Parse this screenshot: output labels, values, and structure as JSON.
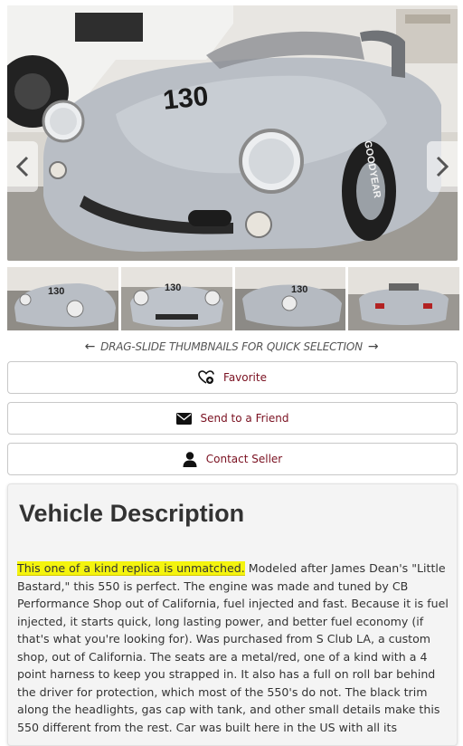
{
  "gallery": {
    "prev_icon": "chevron-left-icon",
    "next_icon": "chevron-right-icon",
    "car_number": "130",
    "tire_text": "GOODYEAR",
    "thumbnails": [
      {
        "label": "130"
      },
      {
        "label": "130"
      },
      {
        "label": "130"
      },
      {
        "label": ""
      }
    ]
  },
  "hint": {
    "text": "DRAG-SLIDE THUMBNAILS FOR QUICK SELECTION",
    "left_icon": "arrow-left-icon",
    "right_icon": "arrow-right-icon"
  },
  "actions": {
    "favorite": {
      "label": "Favorite",
      "icon": "heart-plus-icon"
    },
    "send": {
      "label": "Send to a Friend",
      "icon": "envelope-icon"
    },
    "contact": {
      "label": "Contact Seller",
      "icon": "user-icon"
    }
  },
  "description": {
    "title": "Vehicle Description",
    "highlight": "This one of a kind replica is unmatched.",
    "body": " Modeled after James Dean's \"Little Bastard,\" this 550 is perfect. The engine was made and tuned by CB Performance Shop out of California, fuel injected and fast. Because it is fuel injected, it starts quick, long lasting power, and better fuel economy (if that's what you're looking for). Was purchased from S Club LA, a custom shop, out of California. The seats are a metal/red, one of a kind with a 4 point harness to keep you strapped in. It also has a full on roll bar behind the driver for protection, which most of the 550's do not. The black trim along the headlights, gas cap with tank, and other small details make this 550 different from the rest. Car was built here in the US with all its"
  },
  "colors": {
    "accent": "#7a1020",
    "highlight": "#f4f40e",
    "car_silver": "#b7bcc3"
  }
}
